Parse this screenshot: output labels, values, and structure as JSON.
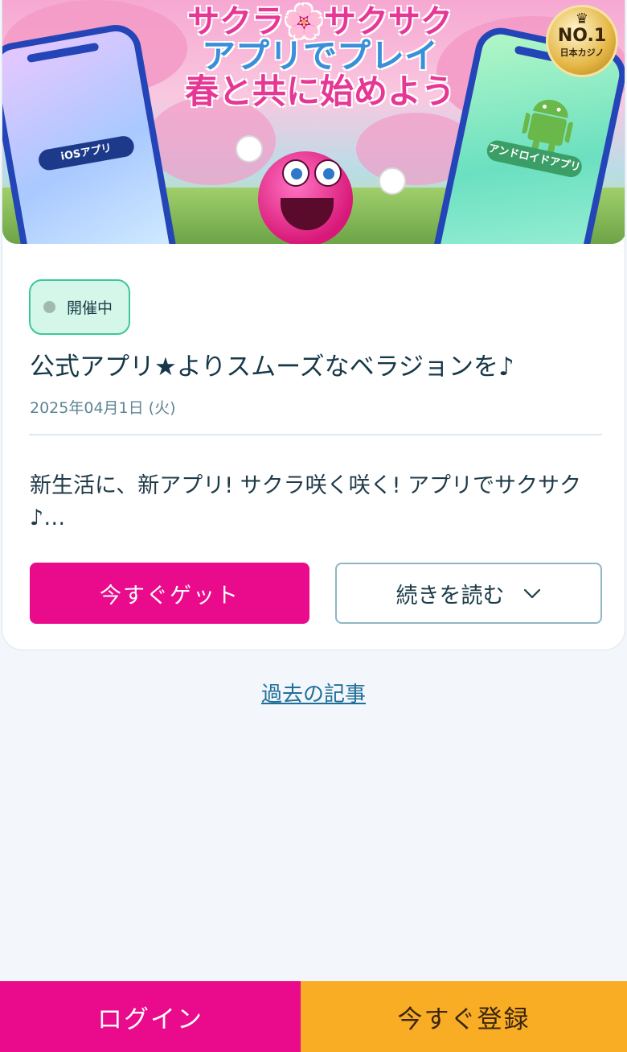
{
  "banner": {
    "title_line1": "サクラ🌸サクサク",
    "title_line2": "アプリでプレイ",
    "title_line3": "春と共に始めよう",
    "ios_tag": "iOSアプリ",
    "android_tag": "アンドロイドアプリ",
    "badge_no": "NO.1",
    "badge_sub": "日本カジノ"
  },
  "article": {
    "status": "開催中",
    "title": "公式アプリ★よりスムーズなベラジョンを♪",
    "date": "2025年04月1日 (火)",
    "excerpt": "新生活に、新アプリ! サクラ咲く咲く! アプリでサクサク♪…",
    "get_button": "今すぐゲット",
    "more_button": "続きを読む"
  },
  "past_link": "過去の記事",
  "footer": {
    "login": "ログイン",
    "register": "今すぐ登録"
  },
  "colors": {
    "primary_pink": "#ea0a8c",
    "register_orange": "#f8ad25",
    "status_green": "#3cc79a"
  }
}
